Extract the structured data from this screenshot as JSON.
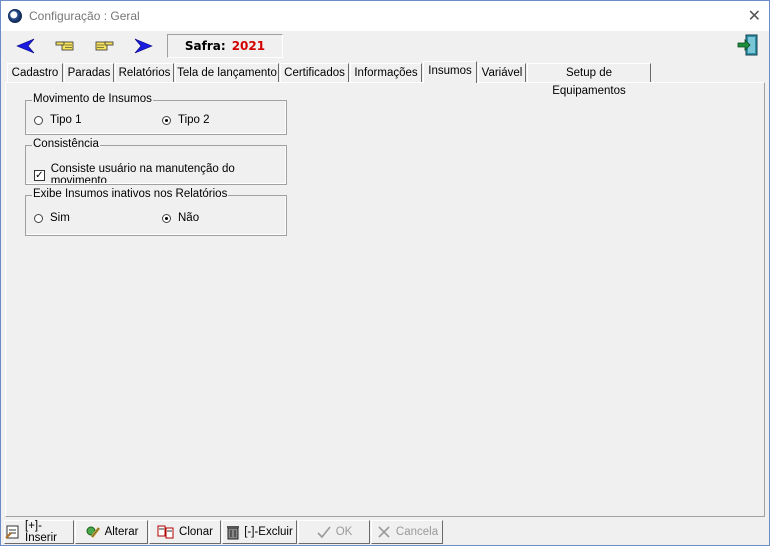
{
  "window": {
    "title": "Configuração : Geral",
    "close_glyph": "✕"
  },
  "toolbar": {
    "safra_label": "Safra:",
    "safra_year": "2021",
    "nav": [
      "arrow-left-icon",
      "hand-pointing-left-icon",
      "hand-pointing-right-icon",
      "arrow-right-icon"
    ]
  },
  "tabs": [
    {
      "label": "Cadastro"
    },
    {
      "label": "Paradas"
    },
    {
      "label": "Relatórios"
    },
    {
      "label": "Tela de lançamento"
    },
    {
      "label": "Certificados"
    },
    {
      "label": "Informações"
    },
    {
      "label": "Insumos",
      "active": true
    },
    {
      "label": "Variável"
    },
    {
      "label": "Setup de Equipamentos"
    }
  ],
  "groups": {
    "movimento": {
      "legend": "Movimento de Insumos",
      "opt1": "Tipo 1",
      "opt2": "Tipo 2",
      "selected": "Tipo 2"
    },
    "consistencia": {
      "legend": "Consistência",
      "check_label": "Consiste usuário na manutenção do movimento",
      "checked": true
    },
    "inativos": {
      "legend": "Exibe Insumos inativos nos Relatórios",
      "opt1": "Sim",
      "opt2": "Não",
      "selected": "Não"
    }
  },
  "bottom": {
    "inserir": "[+]-Inserir",
    "alterar": "Alterar",
    "clonar": "Clonar",
    "excluir": "[-]-Excluir",
    "ok": "OK",
    "cancela": "Cancela"
  },
  "colors": {
    "accent_year": "#d40000",
    "arrow_blue": "#1c1ce0"
  }
}
